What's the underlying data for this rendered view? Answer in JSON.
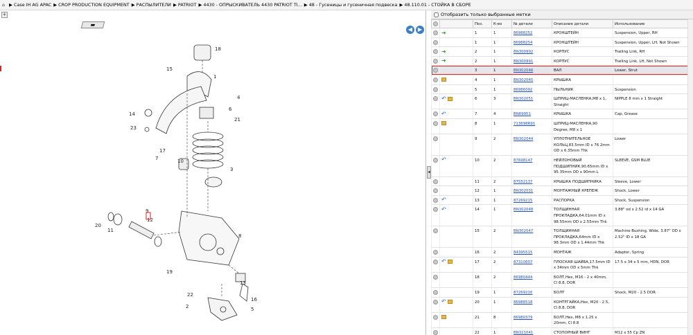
{
  "breadcrumb": [
    "Case IH AG APAC",
    "CROP PRODUCTION EQUIPMENT",
    "РАСПЫЛИТЕЛИ",
    "PATRIOT",
    "4430 - ОПРЫСКИВАТЕЛЬ 4430 PATRIOT TI...",
    "48 - Гусеницы и гусеничная подвеска",
    "48.110.01 - СТОЙКА В СБОРЕ"
  ],
  "filter": {
    "label": "Отобразить только выбранные метки"
  },
  "table": {
    "headers": [
      "",
      "",
      "Поз.",
      "К-во",
      "№ детали",
      "Описание детали",
      "Использование"
    ],
    "rows": [
      {
        "icons": [
          "circ",
          "grn"
        ],
        "pos": "1",
        "qty": "1",
        "part": "86988252",
        "desc": "КРОНШТЕЙН",
        "use": "Suspension, Upper, RH"
      },
      {
        "icons": [
          "circ"
        ],
        "pos": "1",
        "qty": "1",
        "part": "86988254",
        "desc": "КРОНШТЕЙН",
        "use": "Suspension, Upper, LH, Not Shown"
      },
      {
        "icons": [
          "circ",
          "grn"
        ],
        "pos": "2",
        "qty": "1",
        "part": "BN300992",
        "desc": "КОРПУС",
        "use": "Trailing Link, RH"
      },
      {
        "icons": [
          "circ",
          "grn"
        ],
        "pos": "2",
        "qty": "1",
        "part": "BN300991",
        "desc": "КОРПУС",
        "use": "Trailing Link, LH, Not Shown"
      },
      {
        "icons": [
          "circ"
        ],
        "pos": "3",
        "qty": "1",
        "part": "BN302046",
        "desc": "ВАЛ",
        "use": "Lower, Strut",
        "selected": true
      },
      {
        "icons": [
          "circ",
          "box"
        ],
        "pos": "4",
        "qty": "1",
        "part": "BN302045",
        "desc": "КРЫШКА",
        "use": ""
      },
      {
        "icons": [
          "circ"
        ],
        "pos": "5",
        "qty": "1",
        "part": "86986092",
        "desc": "ПЫЛЬНИК",
        "use": "Suspension"
      },
      {
        "icons": [
          "circ",
          "blu",
          "box"
        ],
        "pos": "6",
        "qty": "3",
        "part": "BN302051",
        "desc": "ШПРИЦ-МАСЛЕНКА,M8 x 1, Straight",
        "use": "NIPPLE 8 mm x 1 Straight"
      },
      {
        "icons": [
          "circ",
          "blu"
        ],
        "pos": "7",
        "qty": "4",
        "part": "BN69951",
        "desc": "КРЫШКА",
        "use": "Cap, Grease"
      },
      {
        "icons": [
          "circ",
          "box"
        ],
        "pos": "8",
        "qty": "1",
        "part": "713698R91",
        "desc": "ШПРИЦ-МАСЛЕНКА,90 Degree, M8 x 1",
        "use": ""
      },
      {
        "icons": [
          "circ"
        ],
        "pos": "9",
        "qty": "2",
        "part": "BN302044",
        "desc": "УПЛОТНИТЕЛЬНОЕ КОЛЬЦ,83.5mm ID x 76.2mm OD x 6.35mm Thk",
        "use": "Lower"
      },
      {
        "icons": [
          "circ",
          "blu"
        ],
        "pos": "10",
        "qty": "2",
        "part": "87698147",
        "desc": "НЕЙЛОНОВЫЙ ПОДШИПНИК,90.65mm ID x 95.35mm OD x 90mm L",
        "use": "SLEEVE, GSM BLUE"
      },
      {
        "icons": [
          "circ"
        ],
        "pos": "11",
        "qty": "2",
        "part": "87552137",
        "desc": "КРЫШКА ПОДШИПНИКА",
        "use": "Sleeve, Lower"
      },
      {
        "icons": [
          "circ"
        ],
        "pos": "12",
        "qty": "1",
        "part": "BN302031",
        "desc": "МОНТАЖНЫЙ КРЕПЕЖ",
        "use": "Shock, Lower"
      },
      {
        "icons": [
          "circ",
          "blu"
        ],
        "pos": "13",
        "qty": "1",
        "part": "87269215",
        "desc": "РАСПОРКА",
        "use": "Shock, Suspension"
      },
      {
        "icons": [
          "circ",
          "blu"
        ],
        "pos": "14",
        "qty": "1",
        "part": "BN302048",
        "desc": "ТОЛЩИННАЯ ПРОКЛАДКА,64.01mm ID x 98.55mm OD x 2.55mm Thk",
        "use": "3.88\" od x 2.52 id x 14 GA"
      },
      {
        "icons": [
          "circ"
        ],
        "pos": "15",
        "qty": "2",
        "part": "BN302047",
        "desc": "ТОЛЩИННАЯ ПРОКЛАДКА,64mm ID x 98.3mm OD x 1.44mm Thk",
        "use": "Machine Bushing, Wide, 3.87\" OD x 2.52\" ID x 18 GA"
      },
      {
        "icons": [
          "circ"
        ],
        "pos": "16",
        "qty": "2",
        "part": "84395515",
        "desc": "МОНТАЖ",
        "use": "Adaptor, Spring"
      },
      {
        "icons": [
          "circ",
          "blu",
          "box"
        ],
        "pos": "17",
        "qty": "2",
        "part": "87310607",
        "desc": "ПЛОСКАЯ ШАЙБА,17.5mm ID x 34mm OD x 5mm Thk",
        "use": "17.5 x 34 x 5 mm, HDN, DOR"
      },
      {
        "icons": [
          "circ"
        ],
        "pos": "18",
        "qty": "2",
        "part": "86980444",
        "desc": "БОЛТ,Hex, M16 - 2 x 40mm, Cl 8.8, DOR",
        "use": ""
      },
      {
        "icons": [
          "circ"
        ],
        "pos": "19",
        "qty": "1",
        "part": "87269216",
        "desc": "БОЛТ",
        "use": "Shock, M20 - 2.5 DOR"
      },
      {
        "icons": [
          "circ",
          "blu",
          "box"
        ],
        "pos": "20",
        "qty": "1",
        "part": "86988518",
        "desc": "КОНТРГАЙКА,Hex, M20 - 2.5, Cl 8.8, DOR",
        "use": ""
      },
      {
        "icons": [
          "circ",
          "box"
        ],
        "pos": "21",
        "qty": "8",
        "part": "86980379",
        "desc": "БОЛТ,Hex, M8 x 1.25 x 20mm, Cl 8.8",
        "use": ""
      },
      {
        "icons": [
          "circ"
        ],
        "pos": "22",
        "qty": "1",
        "part": "BN321041",
        "desc": "СТОПОРНЫЙ ВИНТ",
        "use": "M12 x 55 Cp ZN"
      }
    ]
  },
  "callouts": [
    "18",
    "15",
    "1",
    "4",
    "14",
    "23",
    "6",
    "21",
    "17",
    "7",
    "3",
    "10",
    "9",
    "12",
    "20",
    "11",
    "19",
    "8",
    "22",
    "2",
    "16",
    "5",
    "13"
  ]
}
